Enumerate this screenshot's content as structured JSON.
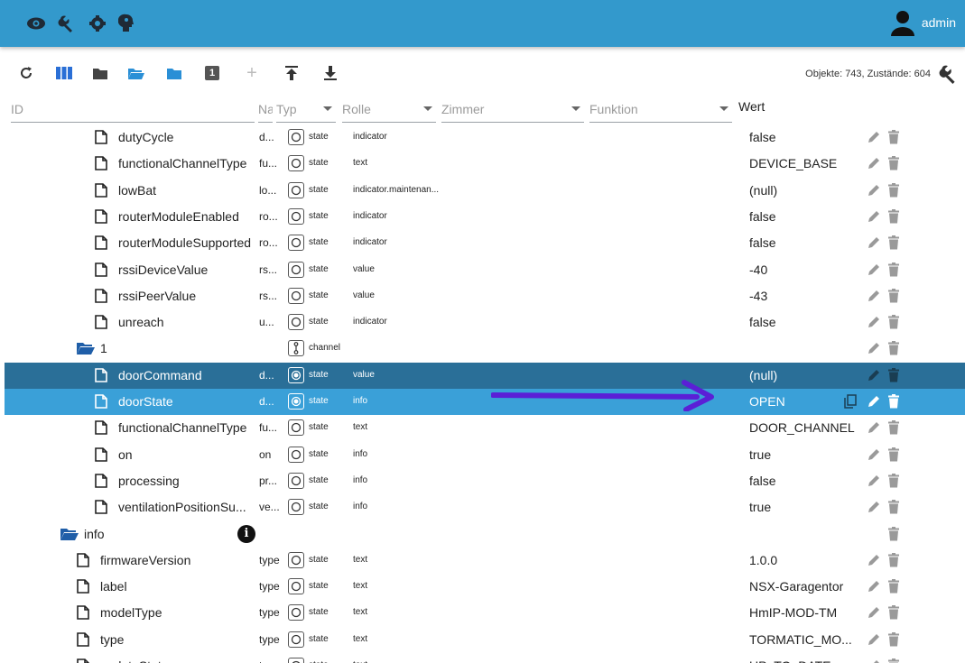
{
  "appbar": {
    "nav_icons": [
      "eye-icon",
      "wrench-icon",
      "settings-icon",
      "head-icon"
    ],
    "user": "admin",
    "color": "#3399cc"
  },
  "toolbar": {
    "buttons": [
      "refresh-icon",
      "columns-icon",
      "folder-icon",
      "folder-open-icon",
      "folder-closed-icon",
      "counter-1-icon",
      "add-icon",
      "upload-icon",
      "download-icon"
    ],
    "counter_label": "1",
    "add_label": "+",
    "stats": "Objekte: 743, Zustände: 604"
  },
  "filters": {
    "id_placeholder": "ID",
    "name_placeholder": "Na",
    "type_placeholder": "Typ",
    "role_placeholder": "Rolle",
    "room_placeholder": "Zimmer",
    "function_placeholder": "Funktion",
    "value_header": "Wert"
  },
  "rows": [
    {
      "name": "dutyCycle",
      "nm": "d...",
      "type": "state",
      "role": "indicator",
      "value": "false",
      "kind": "file",
      "level": 3
    },
    {
      "name": "functionalChannelType",
      "nm": "fu...",
      "type": "state",
      "role": "text",
      "value": "DEVICE_BASE",
      "kind": "file",
      "level": 3
    },
    {
      "name": "lowBat",
      "nm": "lo...",
      "type": "state",
      "role": "indicator.maintenan...",
      "value": "(null)",
      "kind": "file",
      "level": 3
    },
    {
      "name": "routerModuleEnabled",
      "nm": "ro...",
      "type": "state",
      "role": "indicator",
      "value": "false",
      "kind": "file",
      "level": 3
    },
    {
      "name": "routerModuleSupported",
      "nm": "ro...",
      "type": "state",
      "role": "indicator",
      "value": "false",
      "kind": "file",
      "level": 3
    },
    {
      "name": "rssiDeviceValue",
      "nm": "rs...",
      "type": "state",
      "role": "value",
      "value": "-40",
      "kind": "file",
      "level": 3
    },
    {
      "name": "rssiPeerValue",
      "nm": "rs...",
      "type": "state",
      "role": "value",
      "value": "-43",
      "kind": "file",
      "level": 3
    },
    {
      "name": "unreach",
      "nm": "u...",
      "type": "state",
      "role": "indicator",
      "value": "false",
      "kind": "file",
      "level": 3
    },
    {
      "name": "1",
      "nm": "",
      "type": "channel",
      "role": "",
      "value": "",
      "kind": "folder",
      "level": 2
    },
    {
      "name": "doorCommand",
      "nm": "d...",
      "type": "state",
      "role": "value",
      "value": "(null)",
      "kind": "file",
      "level": 3,
      "selected": "dark"
    },
    {
      "name": "doorState",
      "nm": "d...",
      "type": "state",
      "role": "info",
      "value": "OPEN",
      "kind": "file",
      "level": 3,
      "selected": "light"
    },
    {
      "name": "functionalChannelType",
      "nm": "fu...",
      "type": "state",
      "role": "text",
      "value": "DOOR_CHANNEL",
      "kind": "file",
      "level": 3
    },
    {
      "name": "on",
      "nm": "on",
      "type": "state",
      "role": "info",
      "value": "true",
      "kind": "file",
      "level": 3
    },
    {
      "name": "processing",
      "nm": "pr...",
      "type": "state",
      "role": "info",
      "value": "false",
      "kind": "file",
      "level": 3
    },
    {
      "name": "ventilationPositionSu...",
      "nm": "ve...",
      "type": "state",
      "role": "info",
      "value": "true",
      "kind": "file",
      "level": 3
    },
    {
      "name": "info",
      "nm": "",
      "type": "",
      "role": "",
      "value": "",
      "kind": "folder",
      "level": 1
    },
    {
      "name": "firmwareVersion",
      "nm": "type",
      "type": "state",
      "role": "text",
      "value": "1.0.0",
      "kind": "file",
      "level": 2
    },
    {
      "name": "label",
      "nm": "type",
      "type": "state",
      "role": "text",
      "value": "NSX-Garagentor",
      "kind": "file",
      "level": 2
    },
    {
      "name": "modelType",
      "nm": "type",
      "type": "state",
      "role": "text",
      "value": "HmIP-MOD-TM",
      "kind": "file",
      "level": 2
    },
    {
      "name": "type",
      "nm": "type",
      "type": "state",
      "role": "text",
      "value": "TORMATIC_MO...",
      "kind": "file",
      "level": 2
    },
    {
      "name": "updateState",
      "nm": "type",
      "type": "state",
      "role": "text",
      "value": "UP_TO_DATE",
      "kind": "file",
      "level": 2
    }
  ],
  "annotation": {
    "arrow_color": "#5b1fd6"
  }
}
